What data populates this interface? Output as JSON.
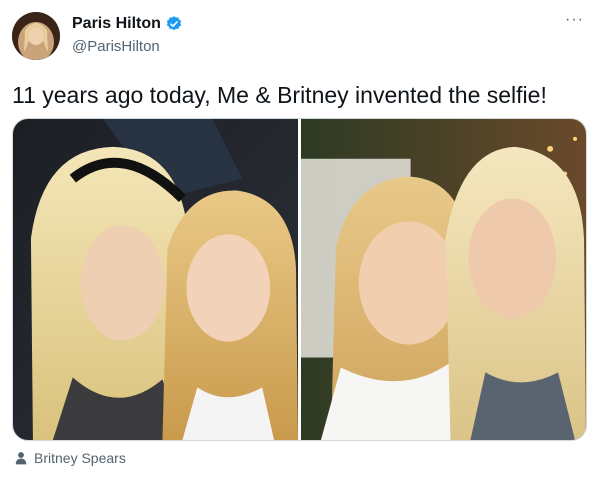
{
  "author": {
    "display_name": "Paris Hilton",
    "handle": "@ParisHilton",
    "verified": true,
    "avatar_icon": "profile-photo"
  },
  "tweet": {
    "text": "11 years ago today, Me & Britney invented the selfie!",
    "more_label": "···"
  },
  "media": {
    "photos": [
      "selfie-photo-left",
      "selfie-photo-right"
    ]
  },
  "tag": {
    "icon": "person-icon",
    "label": "Britney Spears"
  },
  "colors": {
    "verified_blue": "#1d9bf0",
    "secondary_text": "#536471",
    "primary_text": "#0f1419"
  }
}
